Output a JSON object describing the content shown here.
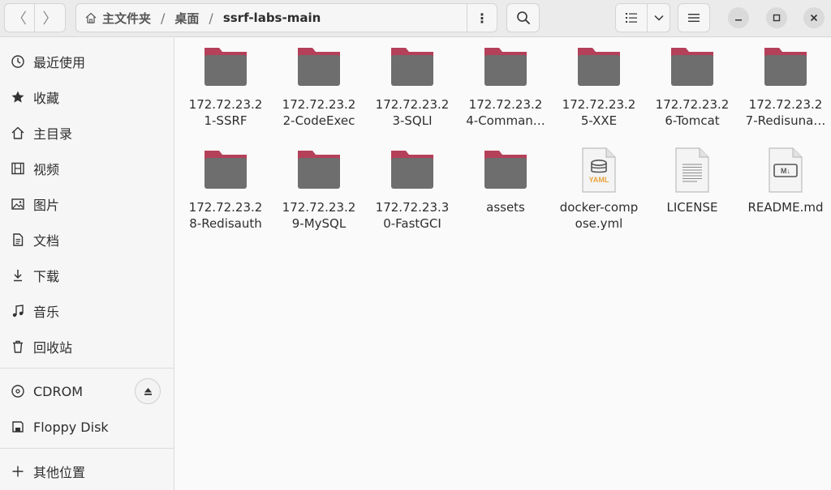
{
  "header": {
    "path": [
      "主文件夹",
      "桌面",
      "ssrf-labs-main"
    ],
    "back_glyph": "〈",
    "forward_glyph": "〉",
    "path_menu_glyph": "⋮"
  },
  "sidebar": {
    "items": [
      {
        "label": "最近使用",
        "icon": "clock-icon"
      },
      {
        "label": "收藏",
        "icon": "star-icon"
      },
      {
        "label": "主目录",
        "icon": "home-icon"
      },
      {
        "label": "视频",
        "icon": "film-icon"
      },
      {
        "label": "图片",
        "icon": "image-icon"
      },
      {
        "label": "文档",
        "icon": "document-icon"
      },
      {
        "label": "下载",
        "icon": "download-icon"
      },
      {
        "label": "音乐",
        "icon": "music-icon"
      },
      {
        "label": "回收站",
        "icon": "trash-icon"
      }
    ],
    "devices": [
      {
        "label": "CDROM",
        "icon": "disc-icon"
      },
      {
        "label": "Floppy Disk",
        "icon": "floppy-icon"
      }
    ],
    "other": {
      "label": "其他位置",
      "icon": "plus-icon"
    }
  },
  "files": [
    {
      "name": "172.72.23.21-SSRF",
      "type": "folder"
    },
    {
      "name": "172.72.23.22-CodeExec",
      "type": "folder"
    },
    {
      "name": "172.72.23.23-SQLI",
      "type": "folder"
    },
    {
      "name": "172.72.23.24-Comman…",
      "type": "folder"
    },
    {
      "name": "172.72.23.25-XXE",
      "type": "folder"
    },
    {
      "name": "172.72.23.26-Tomcat",
      "type": "folder"
    },
    {
      "name": "172.72.23.27-Redisuna…",
      "type": "folder"
    },
    {
      "name": "172.72.23.28-Redisauth",
      "type": "folder"
    },
    {
      "name": "172.72.23.29-MySQL",
      "type": "folder"
    },
    {
      "name": "172.72.23.30-FastGCI",
      "type": "folder"
    },
    {
      "name": "assets",
      "type": "folder"
    },
    {
      "name": "docker-compose.yml",
      "type": "yaml",
      "badge": "YAML"
    },
    {
      "name": "LICENSE",
      "type": "text"
    },
    {
      "name": "README.md",
      "type": "markdown",
      "badge": "M↓"
    }
  ],
  "colors": {
    "folder_tab": "#b4405a",
    "folder_body": "#6e6e6e",
    "yaml_accent": "#e8a33d"
  }
}
